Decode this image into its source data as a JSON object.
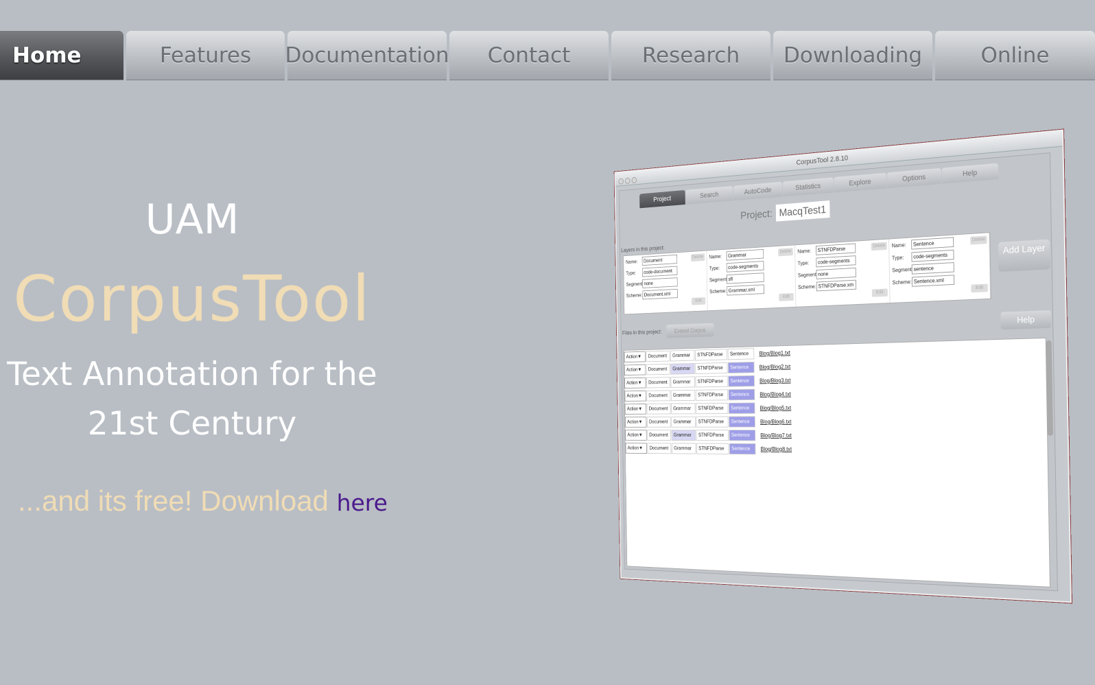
{
  "nav": {
    "tabs": [
      "Home",
      "Features",
      "Documentation",
      "Contact",
      "Research",
      "Downloading",
      "Online"
    ],
    "active": "Home"
  },
  "hero": {
    "line1": "UAM",
    "title": "CorpusTool",
    "tagline1": "Text Annotation for the",
    "tagline2": "21st Century",
    "free_text": "...and its free! Download ",
    "download_link": "here"
  },
  "screenshot": {
    "window_title": "CorpusTool 2.8.10",
    "tabs": [
      "Project",
      "Search",
      "AutoCode",
      "Statistics",
      "Explore",
      "Options",
      "Help"
    ],
    "project_label": "Project:",
    "project_name": "MacqTest1",
    "layers_label": "Layers in this project:",
    "field_labels": [
      "Name:",
      "Type:",
      "Segmenta",
      "Scheme:"
    ],
    "delete_label": "Delete",
    "edit_label": "Edit",
    "layers": [
      {
        "name": "Document",
        "type": "code-document",
        "seg": "none",
        "scheme": "Document.xml"
      },
      {
        "name": "Grammar",
        "type": "code-segments",
        "seg": "sfl",
        "scheme": "Grammar.xml"
      },
      {
        "name": "STNFDParse",
        "type": "code-segments",
        "seg": "none",
        "scheme": "STNFDParse.xm"
      },
      {
        "name": "Sentence",
        "type": "code-segments",
        "seg": "sentence",
        "scheme": "Sentence.xml"
      }
    ],
    "add_layer": "Add Layer",
    "files_label": "Files in this project:",
    "extend_corpus": "Extend Corpus",
    "help": "Help",
    "row_cells": {
      "action": "Action▼",
      "doc": "Document",
      "grammar": "Grammar",
      "stnfd": "STNFDParse",
      "sentence": "Sentence"
    },
    "files": [
      "Blog/Blog1.txt",
      "Blog/Blog2.txt",
      "Blog/Blog3.txt",
      "Blog/Blog4.txt",
      "Blog/Blog5.txt",
      "Blog/Blog6.txt",
      "Blog/Blog7.txt",
      "Blog/Blog8.txt"
    ]
  }
}
